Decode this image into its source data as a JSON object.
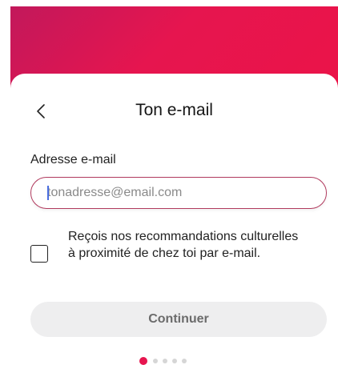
{
  "header": {
    "title": "Ton e-mail",
    "back_icon": "chevron-left-icon"
  },
  "form": {
    "email_label": "Adresse e-mail",
    "email_placeholder": "tonadresse@email.com",
    "email_value": "",
    "newsletter_label": "Reçois nos recommandations culturelles à proximité de chez toi par e-mail.",
    "newsletter_checked": false,
    "continue_label": "Continuer"
  },
  "pager": {
    "total": 5,
    "current": 1
  },
  "colors": {
    "brand": "#e6154f",
    "input_border": "#b13a5e",
    "button_bg": "#eeeeef",
    "button_text": "#6b6b6b"
  }
}
